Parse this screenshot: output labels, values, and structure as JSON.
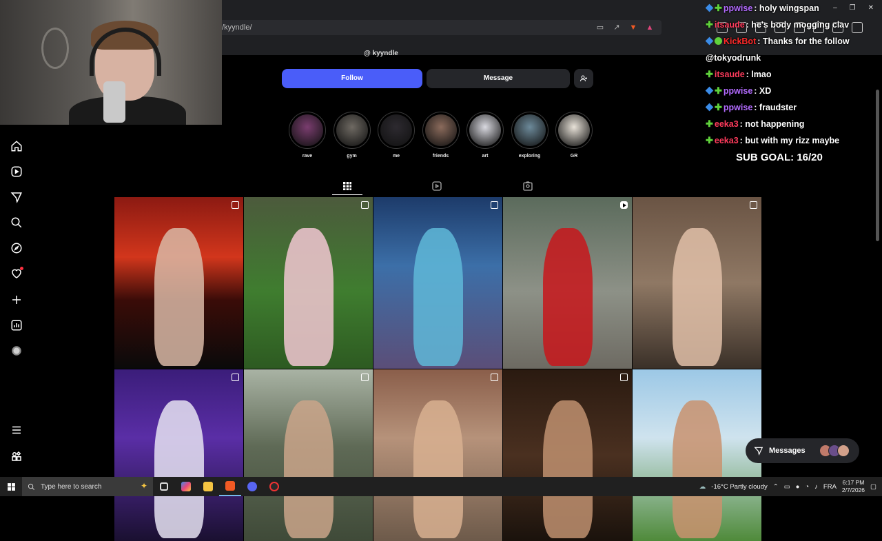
{
  "browser": {
    "url": "n/kyyndle/",
    "window_controls": [
      "–",
      "❐",
      "✕"
    ]
  },
  "profile": {
    "handle": "kyyndle",
    "follow_label": "Follow",
    "message_label": "Message"
  },
  "highlights": [
    {
      "label": "rave",
      "color": "#7a3d6f"
    },
    {
      "label": "gym",
      "color": "#6f6a63"
    },
    {
      "label": "me",
      "color": "#2d2a30"
    },
    {
      "label": "friends",
      "color": "#8b6b5c"
    },
    {
      "label": "art",
      "color": "#d9d9e0"
    },
    {
      "label": "exploring",
      "color": "#6d8a9a"
    },
    {
      "label": "GR",
      "color": "#e8e2d8"
    }
  ],
  "posts": [
    {
      "bg": "linear-gradient(180deg,#8c1a12 0%,#d2361c 35%,#3a0c08 60%,#0a0a0a 100%)",
      "fig": "#d9b9a6",
      "badge": "multi"
    },
    {
      "bg": "linear-gradient(180deg,#4c5a3c 0%,#3f7d2f 55%,#2d5a21 100%)",
      "fig": "#f2c7d2",
      "badge": "multi"
    },
    {
      "bg": "linear-gradient(180deg,#1d3b6a 0%,#3c6fa8 40%,#5b4e78 100%)",
      "fig": "#5fb8d8",
      "badge": "multi"
    },
    {
      "bg": "linear-gradient(180deg,#5b6b5c 0%,#8d9187 55%,#6d6a62 100%)",
      "fig": "#c8161b",
      "badge": "video"
    },
    {
      "bg": "linear-gradient(180deg,#6a5444 0%,#8f7864 50%,#3a3028 100%)",
      "fig": "#e0c0a8",
      "badge": "multi"
    },
    {
      "bg": "linear-gradient(180deg,#3b1d7a 0%,#5a2ea6 40%,#1a1030 100%)",
      "fig": "#e6e3f2",
      "badge": "multi"
    },
    {
      "bg": "linear-gradient(180deg,#a9b3a4 0%,#5f6a56 45%,#3f4a38 100%)",
      "fig": "#caa58a",
      "badge": "multi"
    },
    {
      "bg": "linear-gradient(180deg,#8a5e4a 0%,#b6927a 40%,#6d5a4a 100%)",
      "fig": "#d8b090",
      "badge": "multi"
    },
    {
      "bg": "linear-gradient(180deg,#2a1a10 0%,#4a3020 50%,#1a120c 100%)",
      "fig": "#c09070",
      "badge": "multi"
    },
    {
      "bg": "linear-gradient(180deg,#9cc8e6 0%,#cfe3ee 40%,#4f8a3a 100%)",
      "fig": "#c9926e",
      "badge": "none"
    }
  ],
  "messages_pill": {
    "label": "Messages"
  },
  "chat": [
    {
      "badges": [
        "cube",
        "plus"
      ],
      "name": "ppwise",
      "color": "#b36bff",
      "text": ": holy wingspan"
    },
    {
      "badges": [
        "plus"
      ],
      "name": "itsaude",
      "color": "#ff3b5c",
      "text": ": he's body mogging clav"
    },
    {
      "badges": [
        "cube",
        "check"
      ],
      "name": "KickBot",
      "color": "#ff2a2a",
      "text": ": Thanks for the follow"
    },
    {
      "badges": [],
      "name": "",
      "color": "#ffffff",
      "text": "@tokyodrunk"
    },
    {
      "badges": [
        "plus"
      ],
      "name": "itsaude",
      "color": "#ff3b5c",
      "text": ": lmao"
    },
    {
      "badges": [
        "cube",
        "plus"
      ],
      "name": "ppwise",
      "color": "#b36bff",
      "text": ": XD"
    },
    {
      "badges": [
        "cube",
        "plus"
      ],
      "name": "ppwise",
      "color": "#b36bff",
      "text": ": fraudster"
    },
    {
      "badges": [
        "plus"
      ],
      "name": "eeka3",
      "color": "#ff3b5c",
      "text": ": not happening"
    },
    {
      "badges": [
        "plus"
      ],
      "name": "eeka3",
      "color": "#ff3b5c",
      "text": ": but with my rizz maybe"
    }
  ],
  "sub_goal": "SUB GOAL: 16/20",
  "taskbar": {
    "search_placeholder": "Type here to search",
    "weather": "-16°C  Partly cloudy",
    "language": "FRA",
    "time": "6:17 PM",
    "date": "2/7/2026"
  }
}
